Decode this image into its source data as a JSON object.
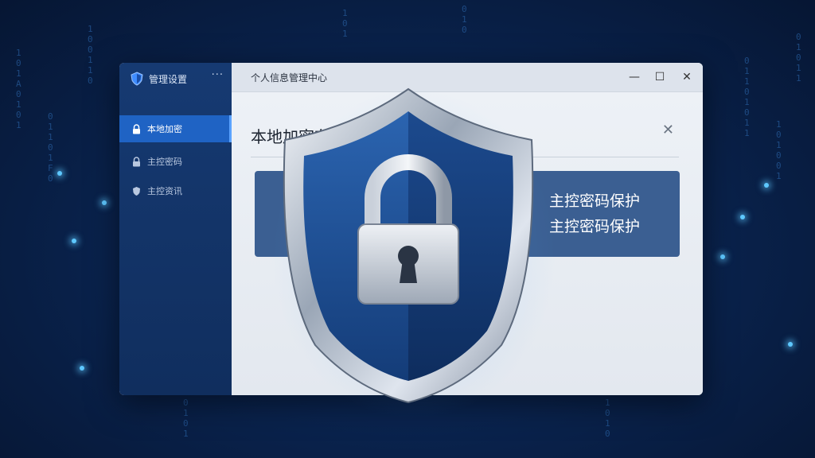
{
  "app": {
    "name": "管理设置",
    "more_icon": "ellipsis-icon"
  },
  "sidebar": {
    "items": [
      {
        "label": "本地加密",
        "icon": "lock-icon",
        "active": true
      },
      {
        "label": "主控密码",
        "icon": "lock-icon",
        "active": false
      },
      {
        "label": "主控资讯",
        "icon": "shield-icon",
        "active": false
      }
    ]
  },
  "window": {
    "title": "个人信息管理中心",
    "minimize": "—",
    "maximize": "☐",
    "close": "✕"
  },
  "panel": {
    "title": "本地加密存储",
    "close": "✕",
    "card_line1": "主控密码保护",
    "card_line2": "主控密码保护"
  },
  "colors": {
    "background": "#0a2450",
    "sidebar": "#163a72",
    "active_item": "#1f63c4",
    "card": "#3b5f92",
    "shield_blue": "#1d4e94"
  }
}
